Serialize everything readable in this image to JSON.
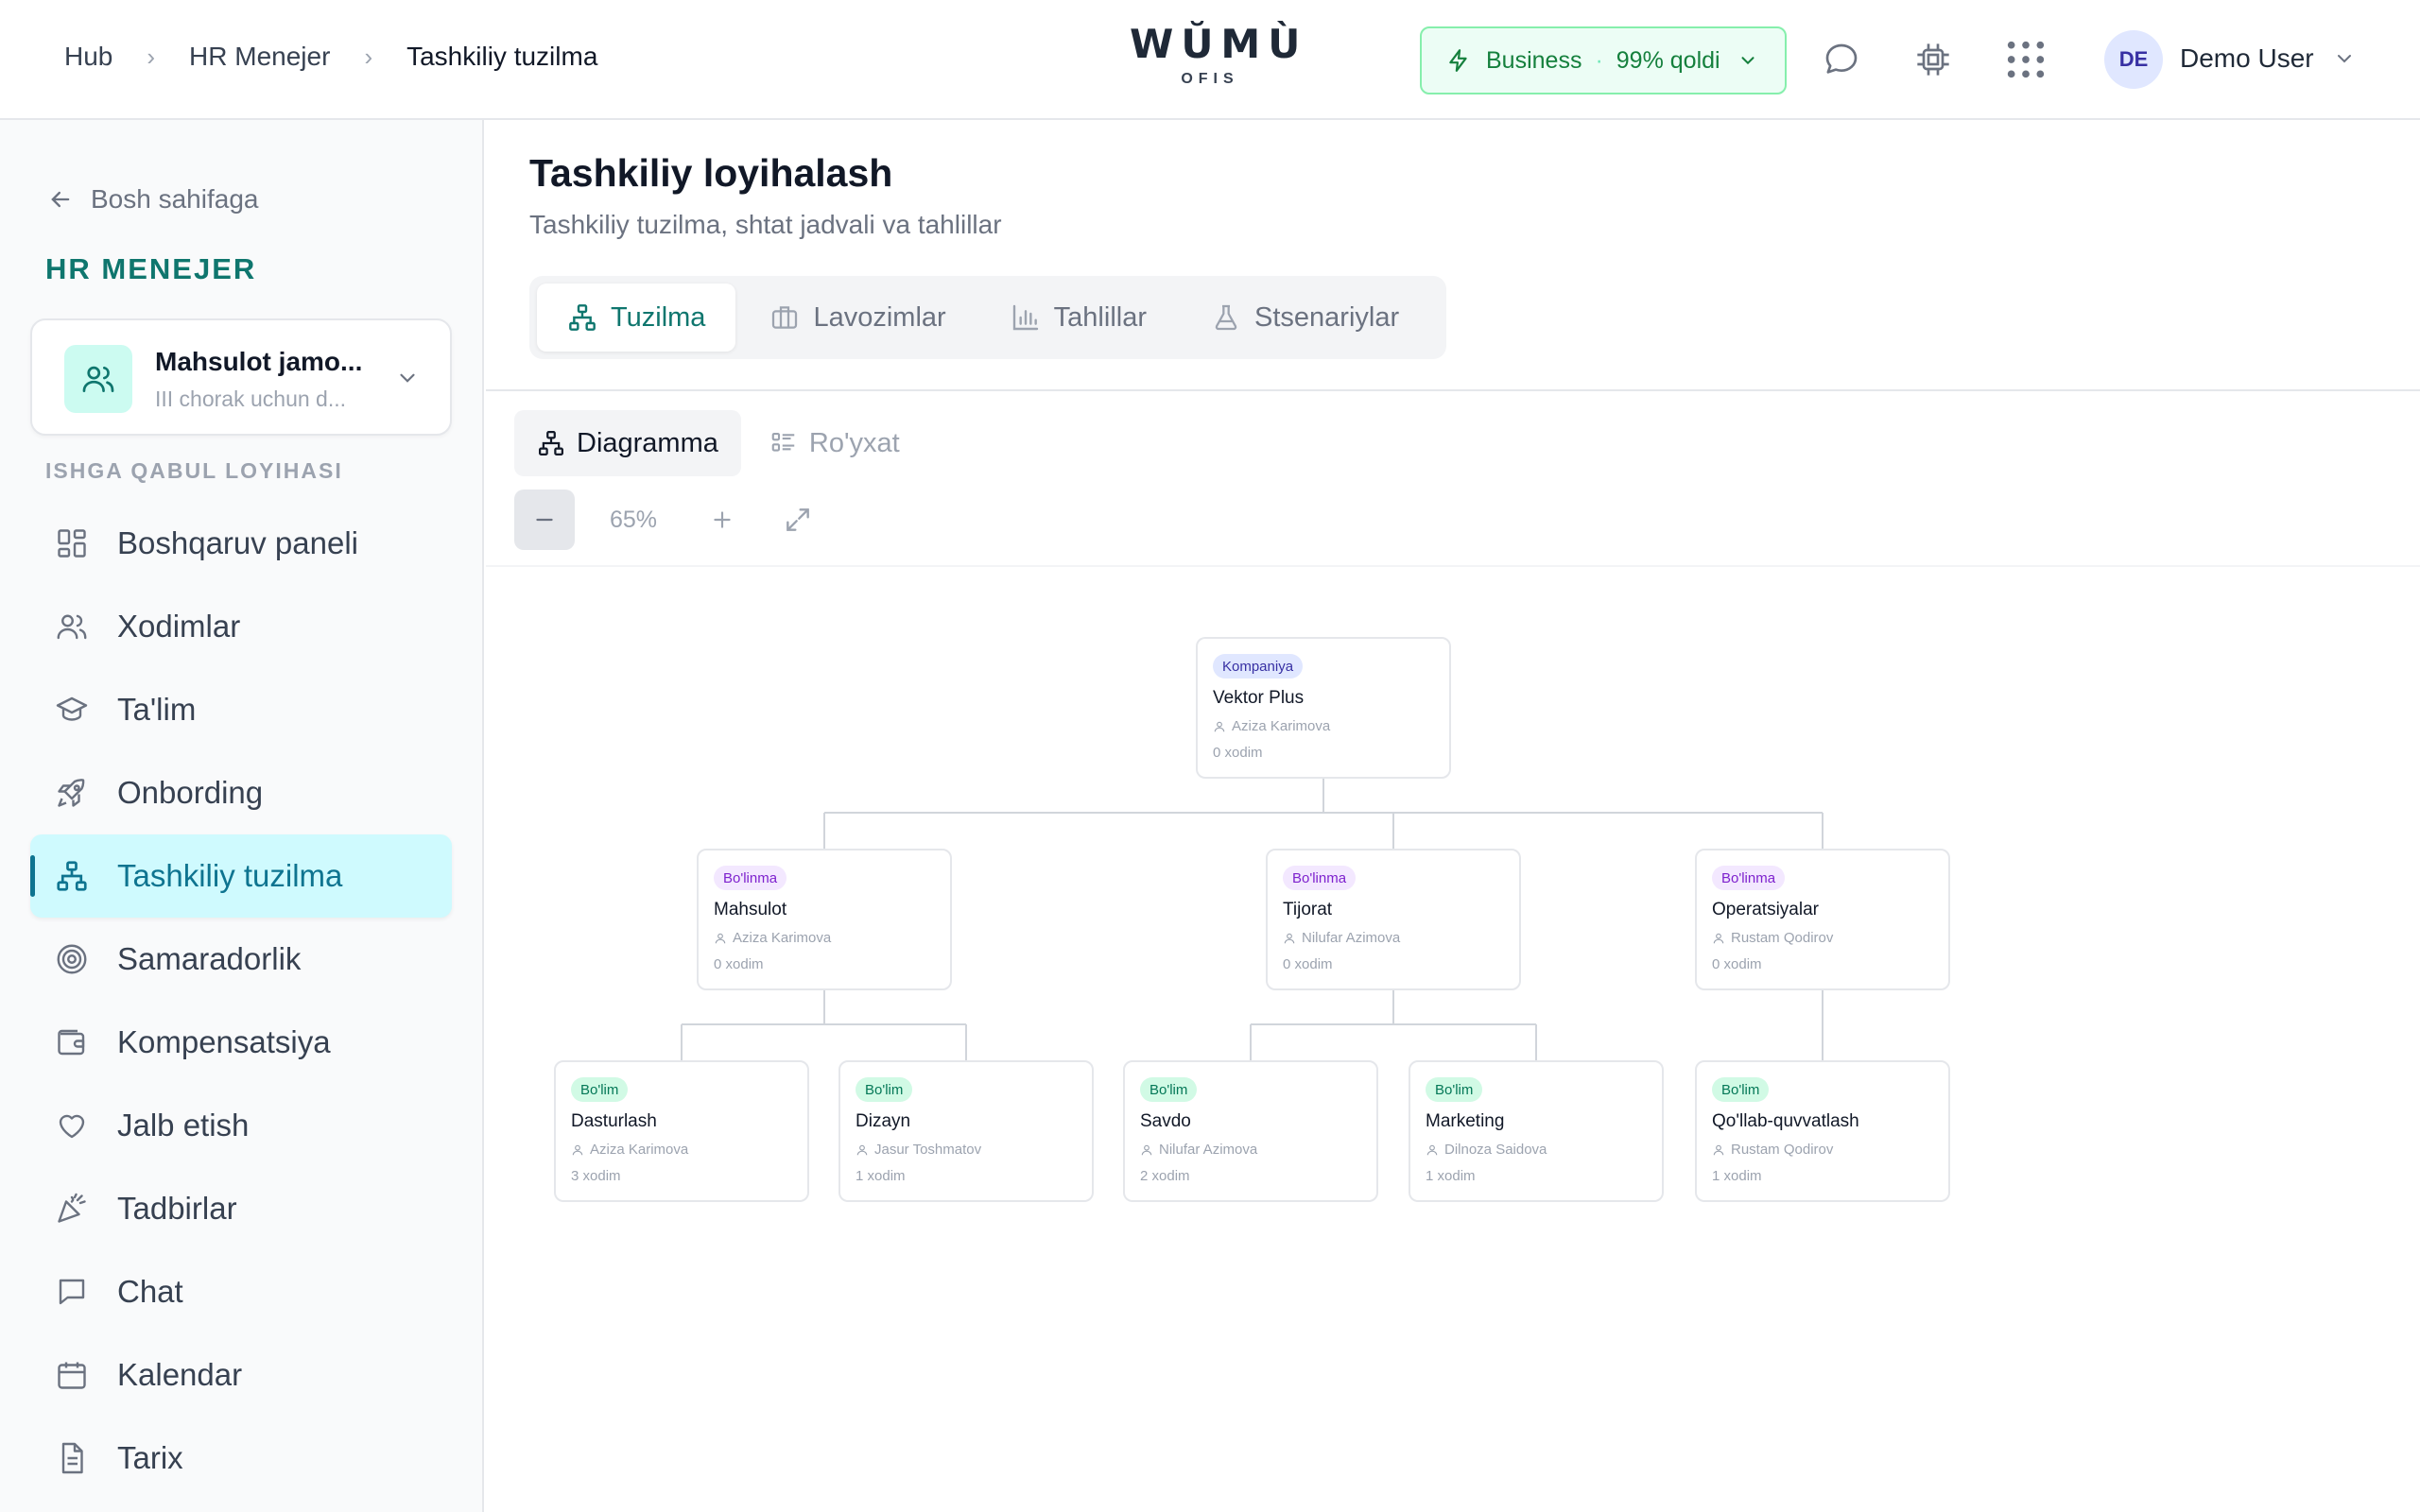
{
  "header": {
    "breadcrumb": [
      "Hub",
      "HR Menejer",
      "Tashkiliy tuzilma"
    ],
    "logo_word": "WŬMÙ",
    "logo_sub": "OFIS",
    "plan_name": "Business",
    "plan_quota": "99% qoldi",
    "user_initials": "DE",
    "user_name": "Demo User"
  },
  "sidebar": {
    "back_label": "Bosh sahifaga",
    "module_title": "HR MENEJER",
    "project_name": "Mahsulot jamo...",
    "project_desc": "III chorak uchun d...",
    "section_label": "ISHGA QABUL LOYIHASI",
    "items": [
      {
        "label": "Boshqaruv paneli",
        "icon": "dashboard-icon"
      },
      {
        "label": "Xodimlar",
        "icon": "users-icon"
      },
      {
        "label": "Ta'lim",
        "icon": "graduation-cap-icon"
      },
      {
        "label": "Onbording",
        "icon": "rocket-icon"
      },
      {
        "label": "Tashkiliy tuzilma",
        "icon": "org-chart-icon",
        "active": true
      },
      {
        "label": "Samaradorlik",
        "icon": "target-icon"
      },
      {
        "label": "Kompensatsiya",
        "icon": "wallet-icon"
      },
      {
        "label": "Jalb etish",
        "icon": "heart-icon"
      },
      {
        "label": "Tadbirlar",
        "icon": "party-icon"
      },
      {
        "label": "Chat",
        "icon": "chat-icon"
      },
      {
        "label": "Kalendar",
        "icon": "calendar-icon"
      },
      {
        "label": "Tarix",
        "icon": "document-icon"
      }
    ]
  },
  "main": {
    "title": "Tashkiliy loyihalash",
    "subtitle": "Tashkiliy tuzilma, shtat jadvali va tahlillar",
    "tabs": [
      {
        "label": "Tuzilma",
        "active": true
      },
      {
        "label": "Lavozimlar"
      },
      {
        "label": "Tahlillar"
      },
      {
        "label": "Stsenariylar"
      }
    ],
    "view_tabs": [
      {
        "label": "Diagramma",
        "active": true
      },
      {
        "label": "Ro'yxat"
      }
    ],
    "zoom": "65%"
  },
  "org": {
    "nodes": [
      {
        "type": "Kompaniya",
        "name": "Vektor Plus",
        "manager": "Aziza Karimova",
        "count": "0 xodim"
      },
      {
        "type": "Bo'linma",
        "name": "Mahsulot",
        "manager": "Aziza Karimova",
        "count": "0 xodim"
      },
      {
        "type": "Bo'linma",
        "name": "Tijorat",
        "manager": "Nilufar Azimova",
        "count": "0 xodim"
      },
      {
        "type": "Bo'linma",
        "name": "Operatsiyalar",
        "manager": "Rustam Qodirov",
        "count": "0 xodim"
      },
      {
        "type": "Bo'lim",
        "name": "Dasturlash",
        "manager": "Aziza Karimova",
        "count": "3 xodim"
      },
      {
        "type": "Bo'lim",
        "name": "Dizayn",
        "manager": "Jasur Toshmatov",
        "count": "1 xodim"
      },
      {
        "type": "Bo'lim",
        "name": "Savdo",
        "manager": "Nilufar Azimova",
        "count": "2 xodim"
      },
      {
        "type": "Bo'lim",
        "name": "Marketing",
        "manager": "Dilnoza Saidova",
        "count": "1 xodim"
      },
      {
        "type": "Bo'lim",
        "name": "Qo'llab-quvvatlash",
        "manager": "Rustam Qodirov",
        "count": "1 xodim"
      }
    ]
  }
}
